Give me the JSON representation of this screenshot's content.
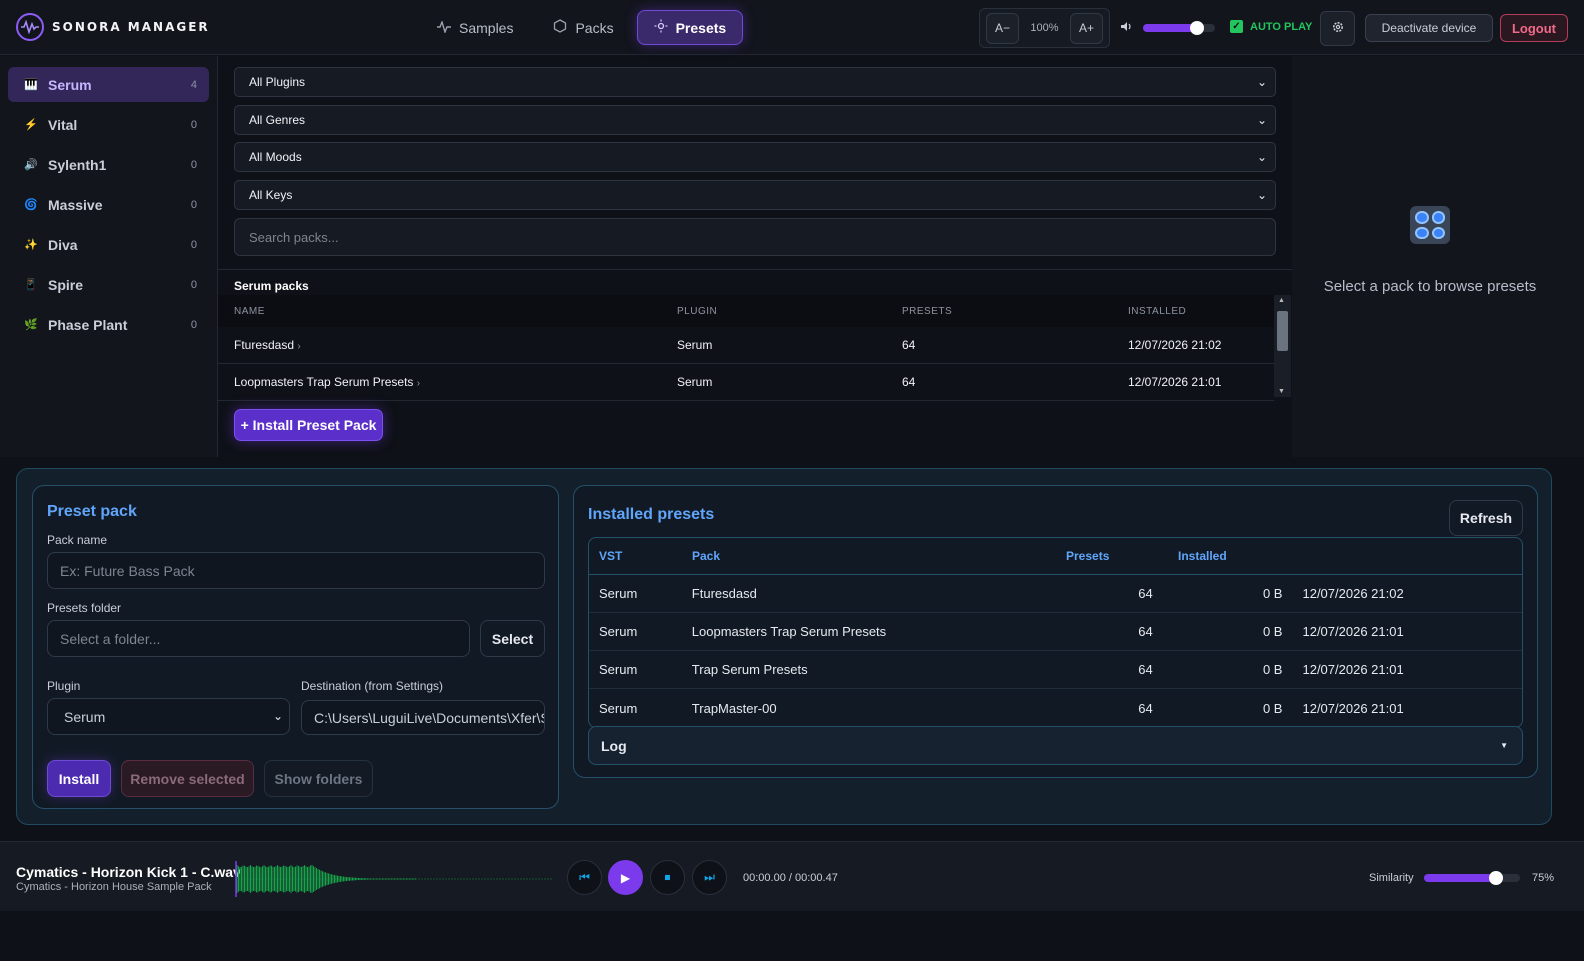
{
  "app": {
    "name": "SONORA MANAGER"
  },
  "nav": {
    "tabs": [
      {
        "label": "Samples",
        "icon": "pulse-icon"
      },
      {
        "label": "Packs",
        "icon": "hexagon-icon"
      },
      {
        "label": "Presets",
        "icon": "sun-icon"
      }
    ],
    "active": "Presets"
  },
  "toolbar": {
    "zoom_out": "A−",
    "zoom_value": "100%",
    "zoom_in": "A+",
    "volume_level": 0.75,
    "autoplay_label": "AUTO PLAY",
    "autoplay_checked": true,
    "deactivate_label": "Deactivate device",
    "logout_label": "Logout"
  },
  "sidebar": {
    "items": [
      {
        "label": "Serum",
        "count": "4",
        "icon": "🎹"
      },
      {
        "label": "Vital",
        "count": "0",
        "icon": "⚡"
      },
      {
        "label": "Sylenth1",
        "count": "0",
        "icon": "🔊"
      },
      {
        "label": "Massive",
        "count": "0",
        "icon": "🌀"
      },
      {
        "label": "Diva",
        "count": "0",
        "icon": "✨"
      },
      {
        "label": "Spire",
        "count": "0",
        "icon": "📱"
      },
      {
        "label": "Phase Plant",
        "count": "0",
        "icon": "🌿"
      }
    ]
  },
  "filters": {
    "plugin": "All Plugins",
    "genre": "All Genres",
    "mood": "All Moods",
    "key": "All Keys",
    "search_placeholder": "Search packs..."
  },
  "packs": {
    "title": "Serum packs",
    "columns": [
      "NAME",
      "PLUGIN",
      "PRESETS",
      "INSTALLED"
    ],
    "rows": [
      {
        "name": "Fturesdasd",
        "plugin": "Serum",
        "presets": "64",
        "installed": "12/07/2026 21:02"
      },
      {
        "name": "Loopmasters Trap Serum Presets",
        "plugin": "Serum",
        "presets": "64",
        "installed": "12/07/2026 21:01"
      }
    ],
    "install_button": "+ Install Preset Pack"
  },
  "right_panel": {
    "message": "Select a pack to browse presets"
  },
  "preset_pack_form": {
    "title": "Preset pack",
    "pack_name_label": "Pack name",
    "pack_name_placeholder": "Ex: Future Bass Pack",
    "folder_label": "Presets folder",
    "folder_placeholder": "Select a folder...",
    "select_button": "Select",
    "plugin_label": "Plugin",
    "plugin_value": "Serum",
    "destination_label": "Destination (from Settings)",
    "destination_value": "C:\\Users\\LuguiLive\\Documents\\Xfer\\Serum Presets",
    "install_button": "Install",
    "remove_button": "Remove selected",
    "show_folders_button": "Show folders"
  },
  "installed_presets": {
    "title": "Installed presets",
    "refresh_button": "Refresh",
    "columns": [
      "VST",
      "Pack",
      "Presets",
      "Installed"
    ],
    "rows": [
      {
        "vst": "Serum",
        "pack": "Fturesdasd",
        "presets": "64",
        "size": "0 B",
        "installed": "12/07/2026 21:02"
      },
      {
        "vst": "Serum",
        "pack": "Loopmasters Trap Serum Presets",
        "presets": "64",
        "size": "0 B",
        "installed": "12/07/2026 21:01"
      },
      {
        "vst": "Serum",
        "pack": "Trap Serum Presets",
        "presets": "64",
        "size": "0 B",
        "installed": "12/07/2026 21:01"
      },
      {
        "vst": "Serum",
        "pack": "TrapMaster-00",
        "presets": "64",
        "size": "0 B",
        "installed": "12/07/2026 21:01"
      }
    ],
    "log_label": "Log"
  },
  "player": {
    "title": "Cymatics - Horizon Kick 1 - C.wav",
    "subtitle": "Cymatics - Horizon House Sample Pack",
    "time": "00:00.00 / 00:00.47",
    "similarity_label": "Similarity",
    "similarity_value": "75%",
    "similarity_level": 0.75
  },
  "colors": {
    "accent": "#7c3aed",
    "link_blue": "#60a5fa",
    "success": "#22c55e",
    "danger": "#f06a8a"
  }
}
